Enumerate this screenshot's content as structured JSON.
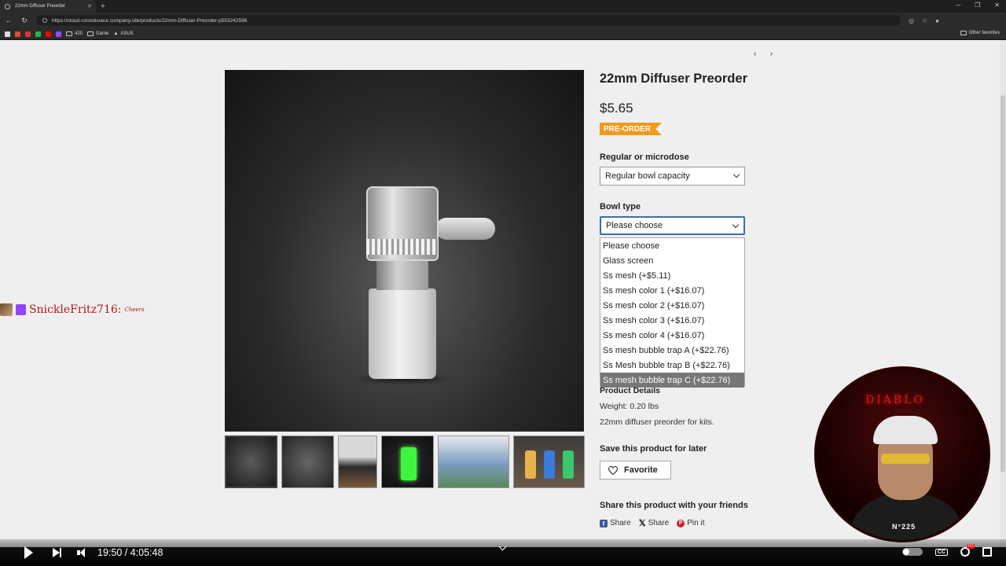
{
  "browser": {
    "tab_title": "22mm Diffuser Preorder",
    "url": "https://cloud-connoisseur.company.site/products/22mm-Diffuser-Preorder-p553242596",
    "bookmarks": [
      "420",
      "Game",
      "ASUS"
    ],
    "other_favorites": "Other favorites"
  },
  "product": {
    "title": "22mm Diffuser Preorder",
    "price": "$5.65",
    "badge": "PRE-ORDER",
    "option1_label": "Regular or microdose",
    "option1_value": "Regular bowl capacity",
    "option2_label": "Bowl type",
    "option2_value": "Please choose",
    "bowl_options": [
      "Please choose",
      "Glass screen",
      "Ss mesh (+$5.11)",
      "Ss mesh color 1 (+$16.07)",
      "Ss mesh color 2 (+$16.07)",
      "Ss mesh color 3 (+$16.07)",
      "Ss mesh color 4 (+$16.07)",
      "Ss mesh bubble trap A (+$22.76)",
      "Ss Mesh bubble trap B (+$22.76)",
      "Ss mesh bubble trap C (+$22.76)"
    ],
    "highlighted_option_index": 9,
    "details_heading": "Product Details",
    "weight": "Weight: 0.20 lbs",
    "description": "22mm diffuser preorder for kits.",
    "save_heading": "Save this product for later",
    "favorite_label": "Favorite",
    "share_heading": "Share this product with your friends",
    "share_facebook": "Share",
    "share_x": "Share",
    "share_pinterest": "Pin it"
  },
  "stream": {
    "chat_user": "SnickleFritz716:",
    "chat_emote": "Cheers",
    "webcam_logo": "DIABLO",
    "shirt_text": "N°225"
  },
  "player": {
    "time": "19:50 / 4:05:48"
  },
  "colors": {
    "badge": "#f19a1b",
    "selected_option": "#777777",
    "focus_border": "#3a6fb0"
  }
}
